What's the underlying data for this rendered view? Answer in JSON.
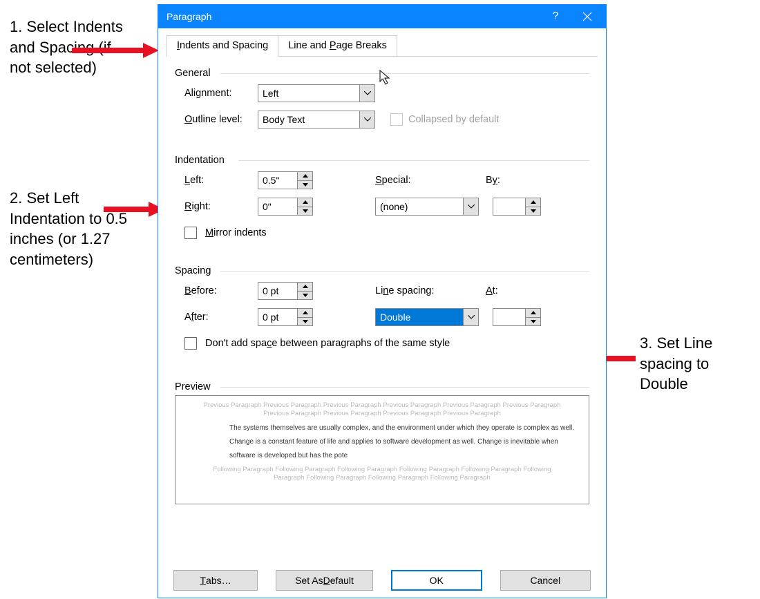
{
  "dialog": {
    "title": "Paragraph",
    "tabs": {
      "active": "Indents and Spacing",
      "inactive": "Line and Page Breaks"
    },
    "general": {
      "title": "General",
      "alignment_label": "Alignment:",
      "alignment_value": "Left",
      "outline_label": "Outline level:",
      "outline_value": "Body Text",
      "collapsed_label": "Collapsed by default"
    },
    "indent": {
      "title": "Indentation",
      "left_label": "Left:",
      "left_value": "0.5\"",
      "right_label": "Right:",
      "right_value": "0\"",
      "special_label": "Special:",
      "special_value": "(none)",
      "by_label": "By:",
      "by_value": "",
      "mirror_label": "Mirror indents"
    },
    "spacing": {
      "title": "Spacing",
      "before_label": "Before:",
      "before_value": "0 pt",
      "after_label": "After:",
      "after_value": "0 pt",
      "line_label": "Line spacing:",
      "line_value": "Double",
      "at_label": "At:",
      "at_value": "",
      "nospace_label": "Don't add space between paragraphs of the same style"
    },
    "preview": {
      "title": "Preview",
      "prev_text": "Previous Paragraph Previous Paragraph Previous Paragraph Previous Paragraph Previous Paragraph Previous Paragraph Previous Paragraph Previous Paragraph Previous Paragraph Previous Paragraph",
      "sample": "The systems themselves are usually complex, and the environment under which they operate is complex as well. Change is a constant feature of life and applies to software development as well. Change is inevitable when software is developed but has the pote",
      "next_text": "Following Paragraph Following Paragraph Following Paragraph Following Paragraph Following Paragraph Following Paragraph Following Paragraph Following Paragraph Following Paragraph"
    },
    "buttons": {
      "tabs": "Tabs…",
      "default": "Set As Default",
      "ok": "OK",
      "cancel": "Cancel"
    }
  },
  "annotations": {
    "a1": "1. Select Indents and Spacing (if not selected)",
    "a2": "2. Set Left Indentation to 0.5 inches (or 1.27 centimeters)",
    "a3": "3. Set Line spacing to Double"
  }
}
